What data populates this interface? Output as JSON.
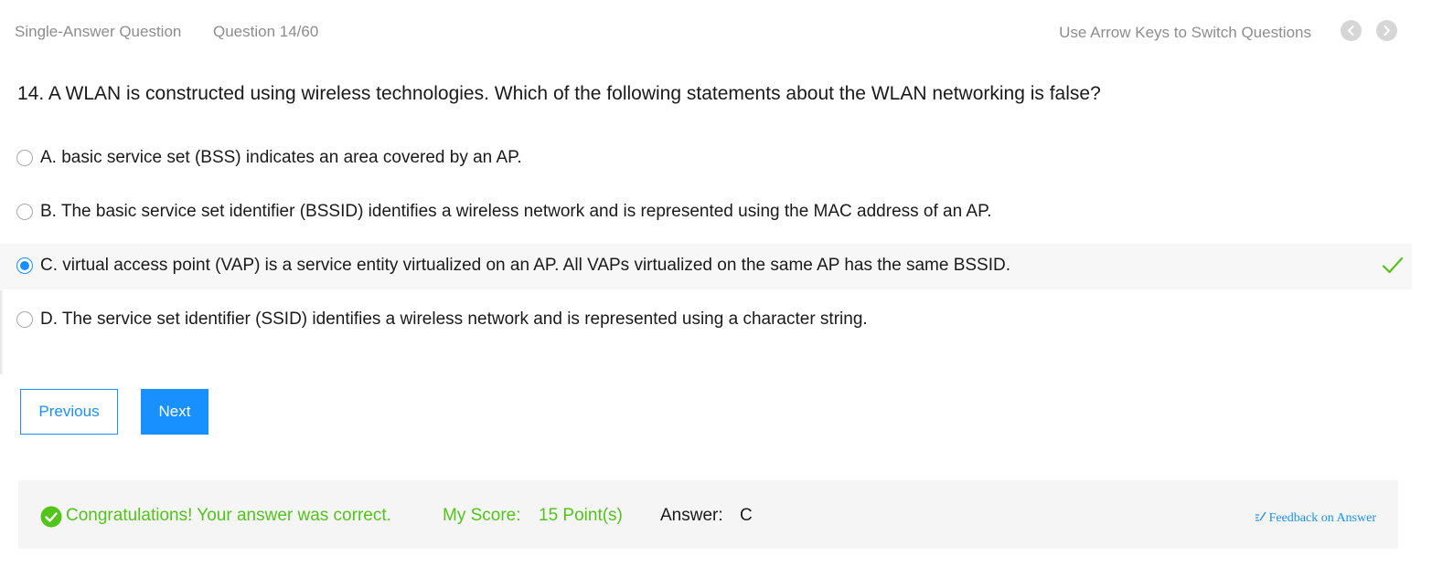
{
  "header": {
    "question_type": "Single-Answer Question",
    "counter": "Question 14/60",
    "hint": "Use Arrow Keys to Switch Questions",
    "prev_icon": "chevron-left-icon",
    "next_icon": "chevron-right-icon"
  },
  "question": {
    "text": "14. A WLAN is constructed using wireless technologies. Which of the following statements about the WLAN networking is false?"
  },
  "options": [
    {
      "label": "A. basic service set (BSS) indicates an area covered by an AP.",
      "selected": false,
      "correct": false
    },
    {
      "label": "B. The basic service set identifier (BSSID) identifies a wireless network and is represented using the MAC address of an AP.",
      "selected": false,
      "correct": false
    },
    {
      "label": "C. virtual access point (VAP) is a service entity virtualized on an AP. All VAPs virtualized on the same AP has the same BSSID.",
      "selected": true,
      "correct": true
    },
    {
      "label": "D. The service set identifier (SSID) identifies a wireless network and is represented using a character string.",
      "selected": false,
      "correct": false
    }
  ],
  "buttons": {
    "previous": "Previous",
    "next": "Next"
  },
  "result": {
    "message": "Congratulations! Your answer was correct.",
    "score_label": "My Score:",
    "score_value": "15 Point(s)",
    "answer_label": "Answer:",
    "answer_value": "C",
    "feedback_link": "Feedback on Answer",
    "feedback_icon": "edit-icon",
    "status_icon": "check-circle-icon"
  },
  "colors": {
    "accent": "#1890ff",
    "success": "#52c41a",
    "muted_text": "#8d8d8d"
  }
}
